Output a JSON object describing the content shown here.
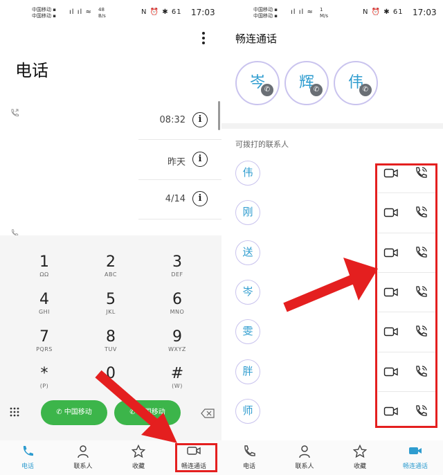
{
  "left": {
    "status": {
      "carrier1": "中国移动",
      "carrier2": "中国移动",
      "speed": "48\nB/s",
      "icons": "N ⏰ ✱ 61",
      "time": "17:03"
    },
    "title": "电话",
    "menu_icon": "more-vert-icon",
    "calls": [
      {
        "time": "08:32"
      },
      {
        "time": "昨天"
      },
      {
        "time": "4/14"
      }
    ],
    "keys": [
      {
        "digit": "1",
        "letters": "ΩΩ"
      },
      {
        "digit": "2",
        "letters": "ABC"
      },
      {
        "digit": "3",
        "letters": "DEF"
      },
      {
        "digit": "4",
        "letters": "GHI"
      },
      {
        "digit": "5",
        "letters": "JKL"
      },
      {
        "digit": "6",
        "letters": "MNO"
      },
      {
        "digit": "7",
        "letters": "PQRS"
      },
      {
        "digit": "8",
        "letters": "TUV"
      },
      {
        "digit": "9",
        "letters": "WXYZ"
      },
      {
        "digit": "*",
        "letters": "(P)"
      },
      {
        "digit": "0",
        "letters": "+"
      },
      {
        "digit": "#",
        "letters": "(W)"
      }
    ],
    "call_btn1": "中国移动",
    "call_btn2": "中国移动",
    "nav": [
      {
        "label": "电话",
        "icon": "phone-icon",
        "active": true
      },
      {
        "label": "联系人",
        "icon": "person-icon",
        "active": false
      },
      {
        "label": "收藏",
        "icon": "star-icon",
        "active": false
      },
      {
        "label": "畅连通话",
        "icon": "video-icon",
        "active": false
      }
    ]
  },
  "right": {
    "status": {
      "carrier1": "中国移动",
      "carrier2": "中国移动",
      "speed": "1\nM/s",
      "icons": "N ⏰ ✱ 61",
      "time": "17:03"
    },
    "title": "畅连通话",
    "favorites": [
      "岑",
      "辉",
      "伟"
    ],
    "section_label": "可拨打的联系人",
    "contacts": [
      "伟",
      "刚",
      "送",
      "岑",
      "雯",
      "胖",
      "师"
    ],
    "nav": [
      {
        "label": "电话",
        "icon": "phone-icon",
        "active": false
      },
      {
        "label": "联系人",
        "icon": "person-icon",
        "active": false
      },
      {
        "label": "收藏",
        "icon": "star-icon",
        "active": false
      },
      {
        "label": "畅连通话",
        "icon": "video-icon",
        "active": true
      }
    ]
  },
  "colors": {
    "accent": "#2e9ccf",
    "green": "#3cb54a",
    "annotation": "#e41f1f"
  }
}
